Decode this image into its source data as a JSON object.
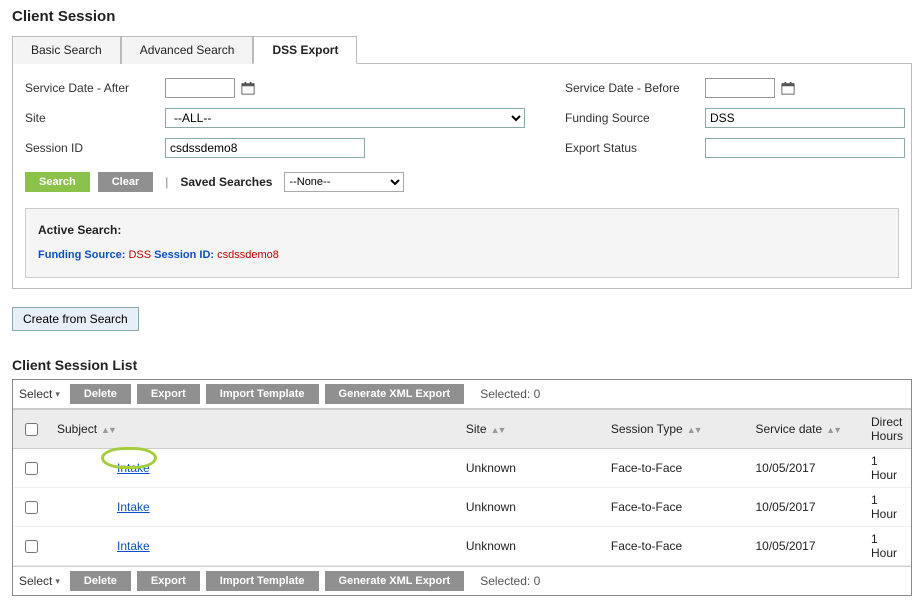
{
  "page_title": "Client Session",
  "tabs": [
    {
      "label": "Basic Search",
      "active": false
    },
    {
      "label": "Advanced Search",
      "active": false
    },
    {
      "label": "DSS Export",
      "active": true
    }
  ],
  "form": {
    "service_date_after_label": "Service Date - After",
    "service_date_after_value": "",
    "site_label": "Site",
    "site_value": "--ALL--",
    "session_id_label": "Session ID",
    "session_id_value": "csdssdemo8",
    "service_date_before_label": "Service Date - Before",
    "service_date_before_value": "",
    "funding_source_label": "Funding Source",
    "funding_source_value": "DSS",
    "export_status_label": "Export Status",
    "export_status_value": ""
  },
  "buttons": {
    "search": "Search",
    "clear": "Clear",
    "saved_searches_label": "Saved Searches",
    "saved_searches_value": "--None--",
    "create_from_search": "Create from Search"
  },
  "active_search": {
    "title": "Active Search:",
    "funding_source_key": "Funding Source:",
    "funding_source_val": "DSS",
    "session_id_key": "Session ID:",
    "session_id_val": "csdssdemo8"
  },
  "list": {
    "section_title": "Client Session List",
    "select_label": "Select",
    "delete": "Delete",
    "export": "Export",
    "import_template": "Import Template",
    "generate_xml": "Generate XML Export",
    "selected_prefix": "Selected:",
    "selected_count": "0",
    "columns": {
      "subject": "Subject",
      "site": "Site",
      "session_type": "Session Type",
      "service_date": "Service date",
      "direct_hours": "Direct Hours"
    },
    "rows": [
      {
        "subject": "Intake",
        "site": "Unknown",
        "session_type": "Face-to-Face",
        "service_date": "10/05/2017",
        "direct_hours": "1 Hour"
      },
      {
        "subject": "Intake",
        "site": "Unknown",
        "session_type": "Face-to-Face",
        "service_date": "10/05/2017",
        "direct_hours": "1 Hour"
      },
      {
        "subject": "Intake",
        "site": "Unknown",
        "session_type": "Face-to-Face",
        "service_date": "10/05/2017",
        "direct_hours": "1 Hour"
      }
    ]
  }
}
